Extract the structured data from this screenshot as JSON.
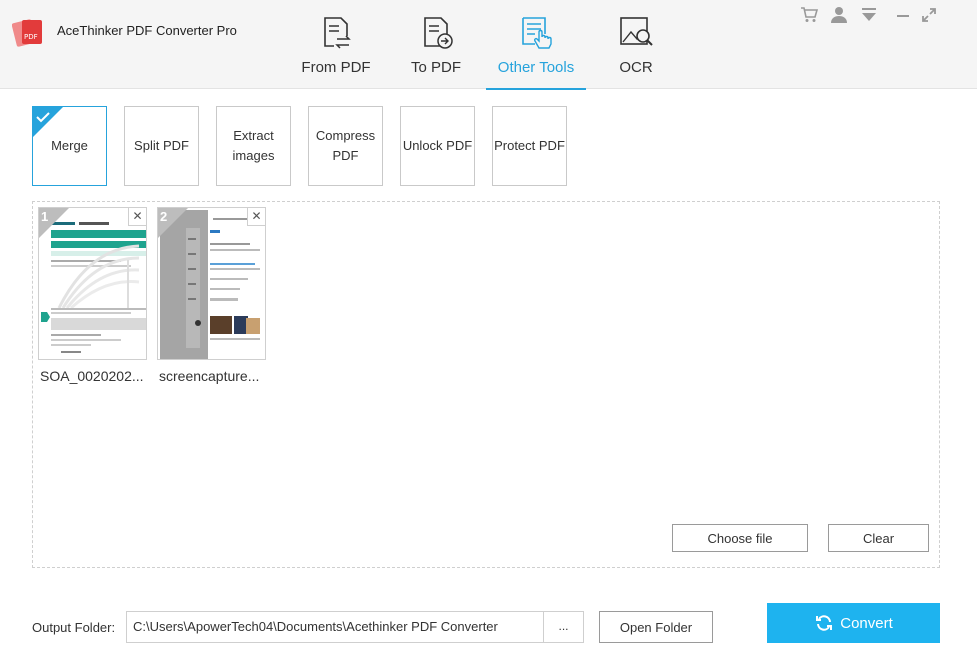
{
  "app": {
    "title": "AceThinker PDF Converter Pro"
  },
  "nav": {
    "tabs": [
      {
        "label": "From PDF",
        "icon": "from-pdf-icon"
      },
      {
        "label": "To PDF",
        "icon": "to-pdf-icon"
      },
      {
        "label": "Other Tools",
        "icon": "other-tools-icon",
        "active": true
      },
      {
        "label": "OCR",
        "icon": "ocr-icon"
      }
    ]
  },
  "window_icons": [
    "cart-icon",
    "user-icon",
    "menu-dropdown-icon",
    "minimize-icon",
    "maximize-icon"
  ],
  "tools": [
    {
      "label": "Merge",
      "active": true
    },
    {
      "label": "Split PDF"
    },
    {
      "label": "Extract images"
    },
    {
      "label": "Compress PDF"
    },
    {
      "label": "Unlock PDF"
    },
    {
      "label": "Protect PDF"
    }
  ],
  "files": [
    {
      "index": "1",
      "name": "SOA_0020202..."
    },
    {
      "index": "2",
      "name": "screencapture..."
    }
  ],
  "dropzone": {
    "choose_label": "Choose file",
    "clear_label": "Clear"
  },
  "footer": {
    "output_label": "Output Folder:",
    "path": "C:\\Users\\ApowerTech04\\Documents\\Acethinker PDF Converter",
    "browse_label": "...",
    "open_folder_label": "Open Folder",
    "convert_label": "Convert"
  },
  "colors": {
    "accent": "#26a3dc",
    "convert": "#1eb3ef",
    "logo_red": "#e23b3b"
  }
}
